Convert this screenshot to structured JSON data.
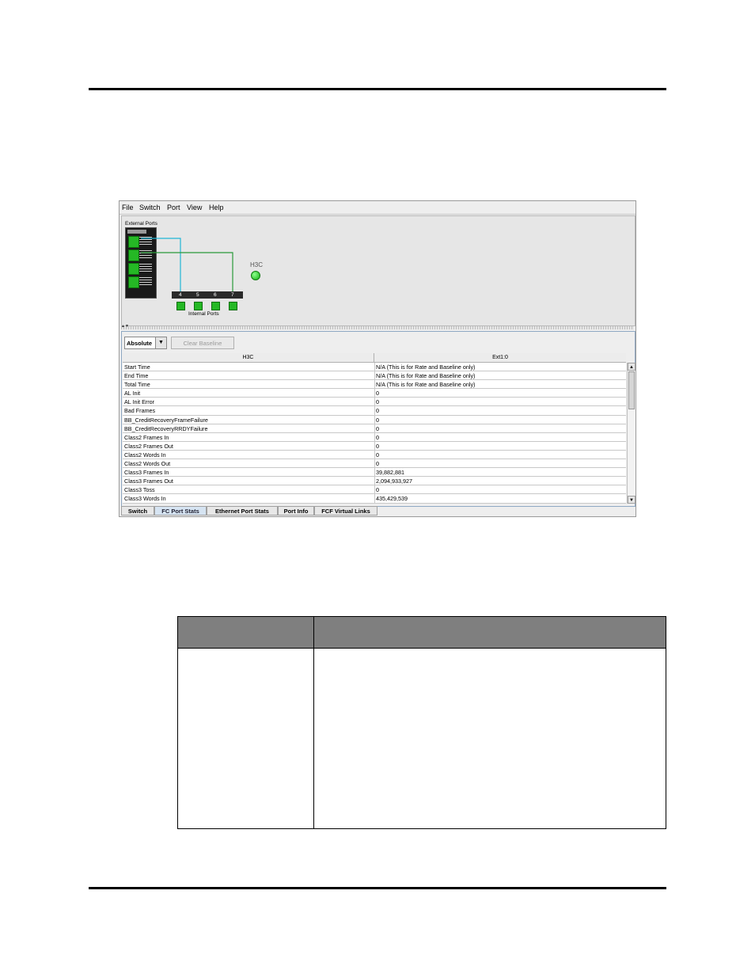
{
  "menu": [
    "File",
    "Switch",
    "Port",
    "View",
    "Help"
  ],
  "topology": {
    "external_label": "External Ports",
    "internal_label": "Internal Ports",
    "bar_labels": [
      "4",
      "5",
      "6",
      "7"
    ],
    "switch_name": "H3C"
  },
  "stats": {
    "mode_value": "Absolute",
    "clear_baseline": "Clear Baseline",
    "columns": [
      "H3C",
      "Ext1:0"
    ],
    "rows": [
      [
        "Start Time",
        "N/A (This is for Rate and Baseline only)"
      ],
      [
        "End Time",
        "N/A (This is for Rate and Baseline only)"
      ],
      [
        "Total Time",
        "N/A (This is for Rate and Baseline only)"
      ],
      [
        "AL Init",
        "0"
      ],
      [
        "AL Init Error",
        "0"
      ],
      [
        "Bad Frames",
        "0"
      ],
      [
        "BB_CreditRecoveryFrameFailure",
        "0"
      ],
      [
        "BB_CreditRecoveryRRDYFailure",
        "0"
      ],
      [
        "Class2 Frames In",
        "0"
      ],
      [
        "Class2 Frames Out",
        "0"
      ],
      [
        "Class2 Words In",
        "0"
      ],
      [
        "Class2 Words Out",
        "0"
      ],
      [
        "Class3 Frames In",
        "39,882,881"
      ],
      [
        "Class3 Frames Out",
        "2,094,933,927"
      ],
      [
        "Class3 Toss",
        "0"
      ],
      [
        "Class3 Words In",
        "435,429,539"
      ]
    ]
  },
  "tabs": [
    "Switch",
    "FC Port Stats",
    "Ethernet Port Stats",
    "Port Info",
    "FCF Virtual Links"
  ],
  "active_tab": "FC Port Stats"
}
